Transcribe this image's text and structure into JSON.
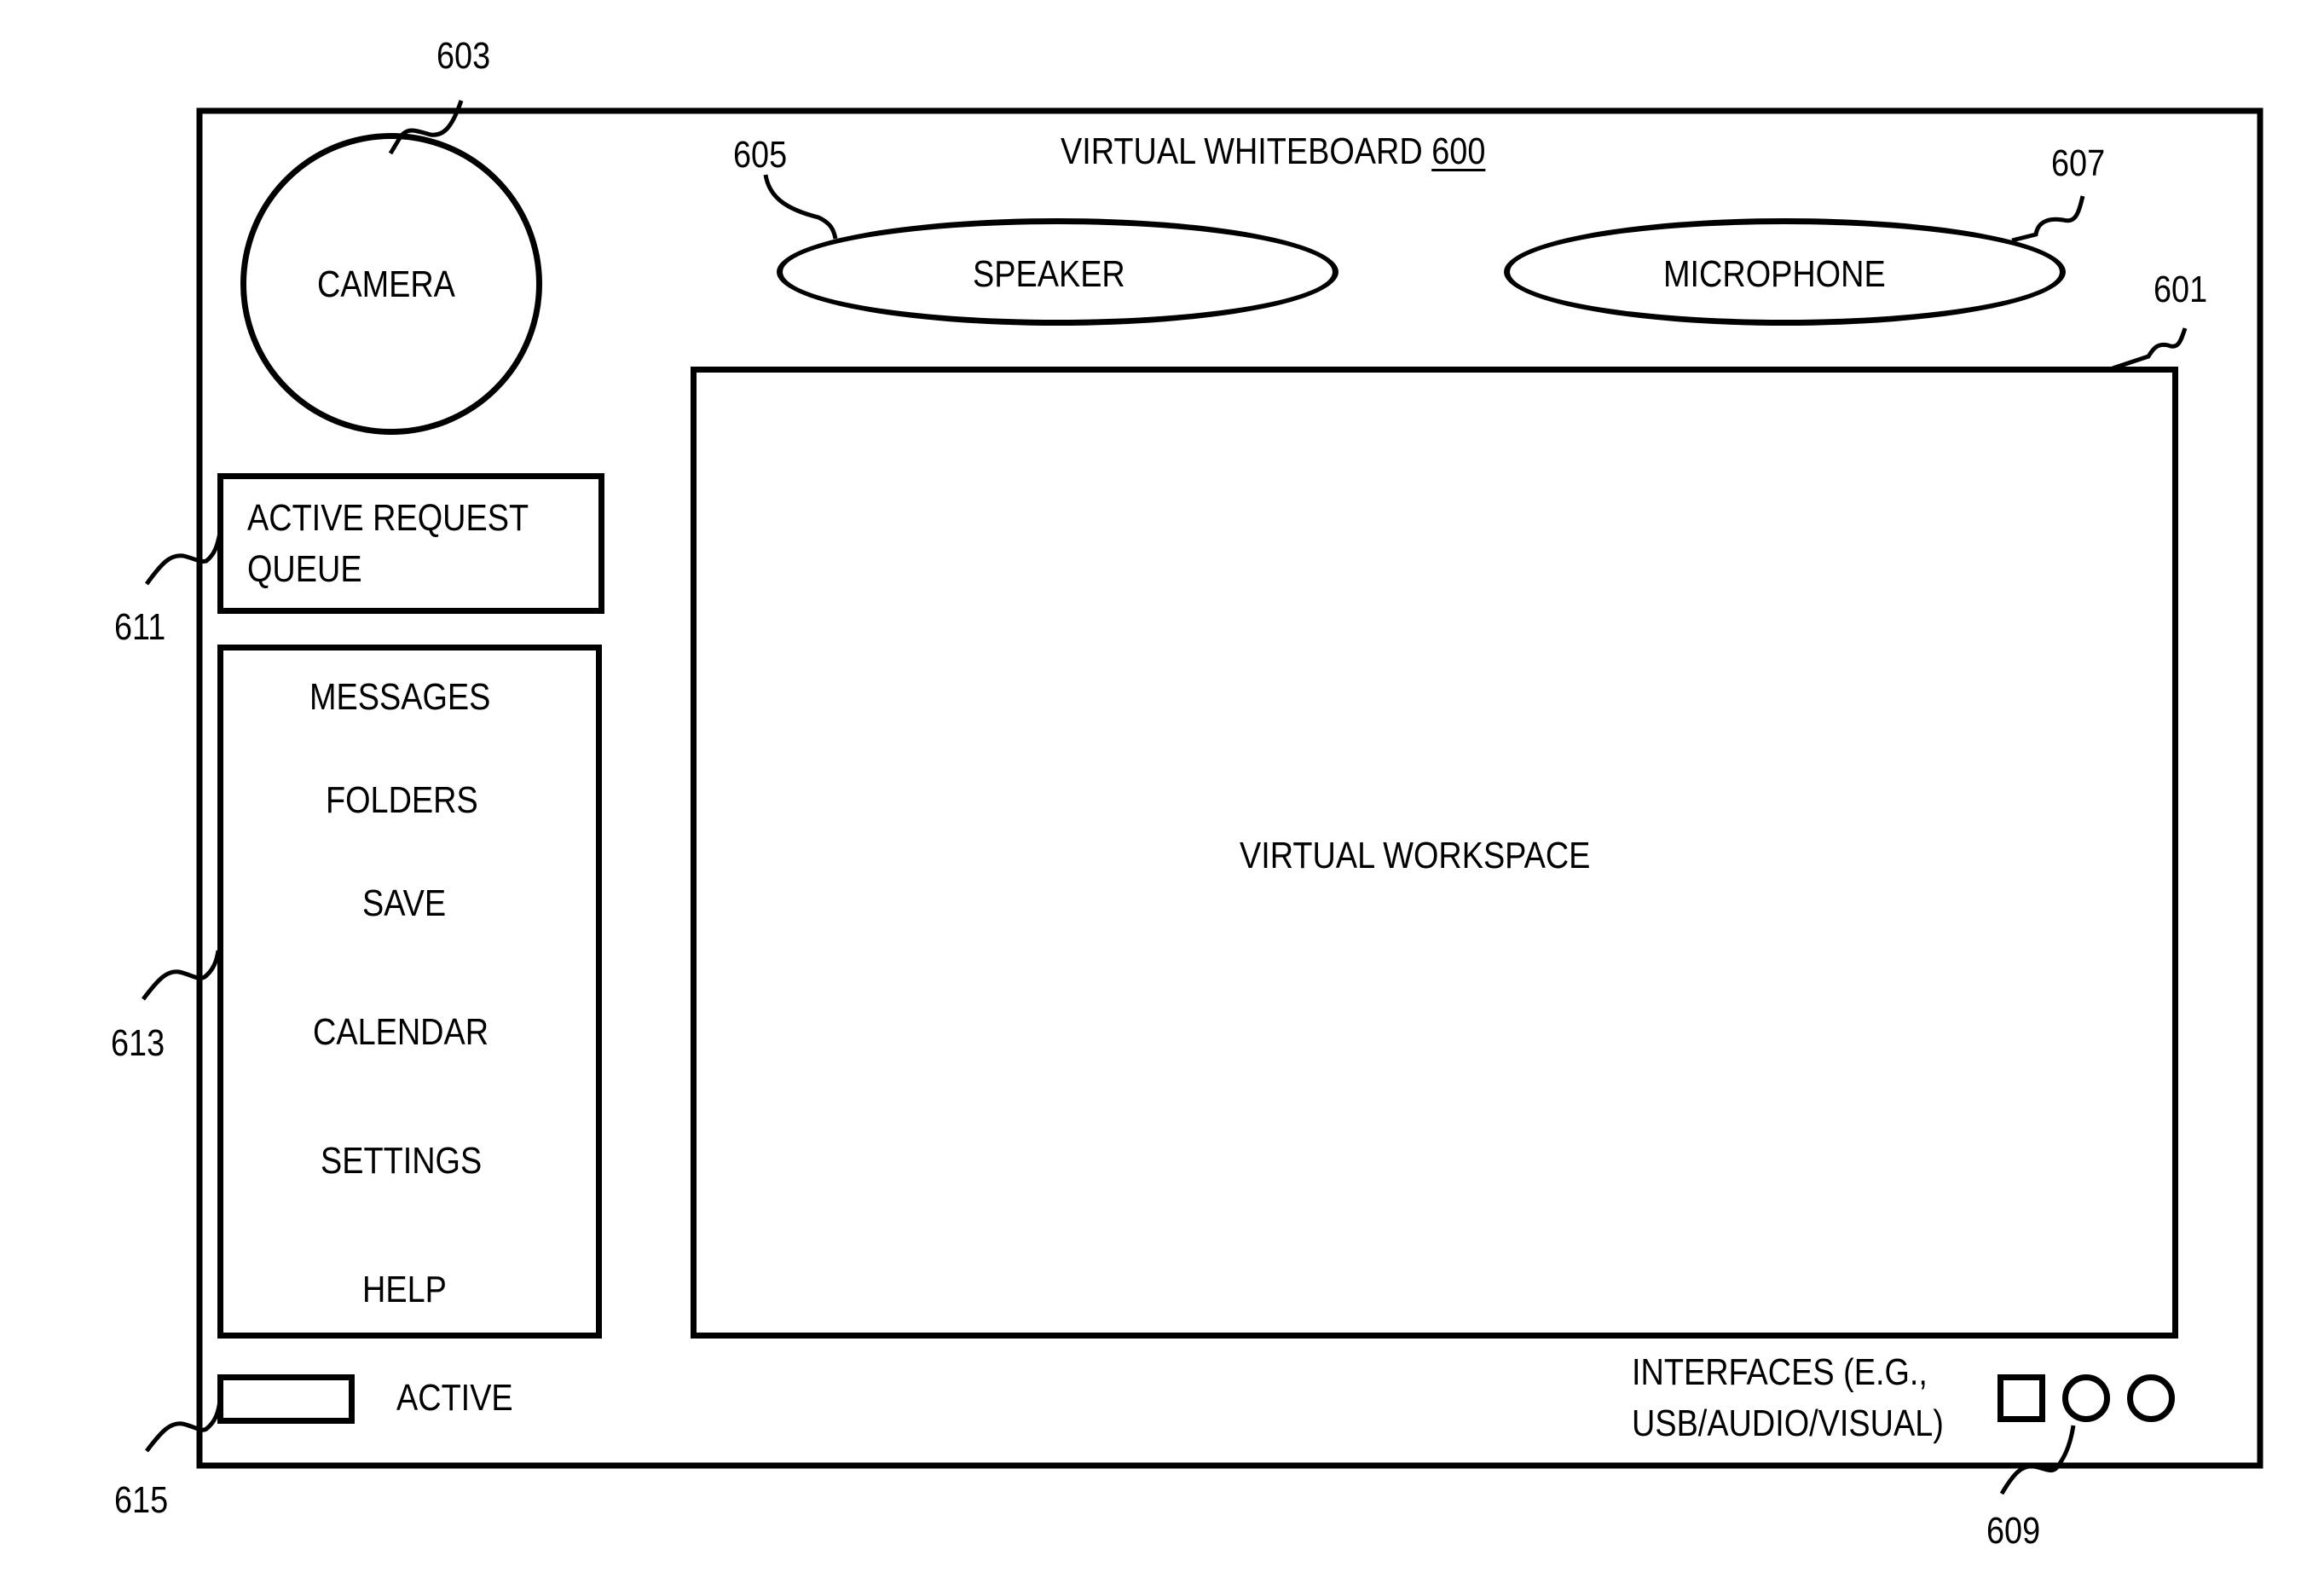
{
  "title": {
    "text": "VIRTUAL WHITEBOARD",
    "ref": "600"
  },
  "camera": {
    "label": "CAMERA",
    "ref": "603"
  },
  "speaker": {
    "label": "SPEAKER",
    "ref": "605"
  },
  "microphone": {
    "label": "MICROPHONE",
    "ref": "607"
  },
  "workspace": {
    "label": "VIRTUAL WORKSPACE",
    "ref": "601"
  },
  "queue": {
    "line1": "ACTIVE REQUEST",
    "line2": "QUEUE",
    "ref": "611"
  },
  "menu": {
    "ref": "613",
    "items": [
      {
        "label": "MESSAGES"
      },
      {
        "label": "FOLDERS"
      },
      {
        "label": "SAVE"
      },
      {
        "label": "CALENDAR"
      },
      {
        "label": "SETTINGS"
      },
      {
        "label": "HELP"
      }
    ]
  },
  "active": {
    "label": "ACTIVE",
    "ref": "615"
  },
  "interfaces": {
    "line1": "INTERFACES (E.G.,",
    "line2": "USB/AUDIO/VISUAL)",
    "ref": "609"
  }
}
